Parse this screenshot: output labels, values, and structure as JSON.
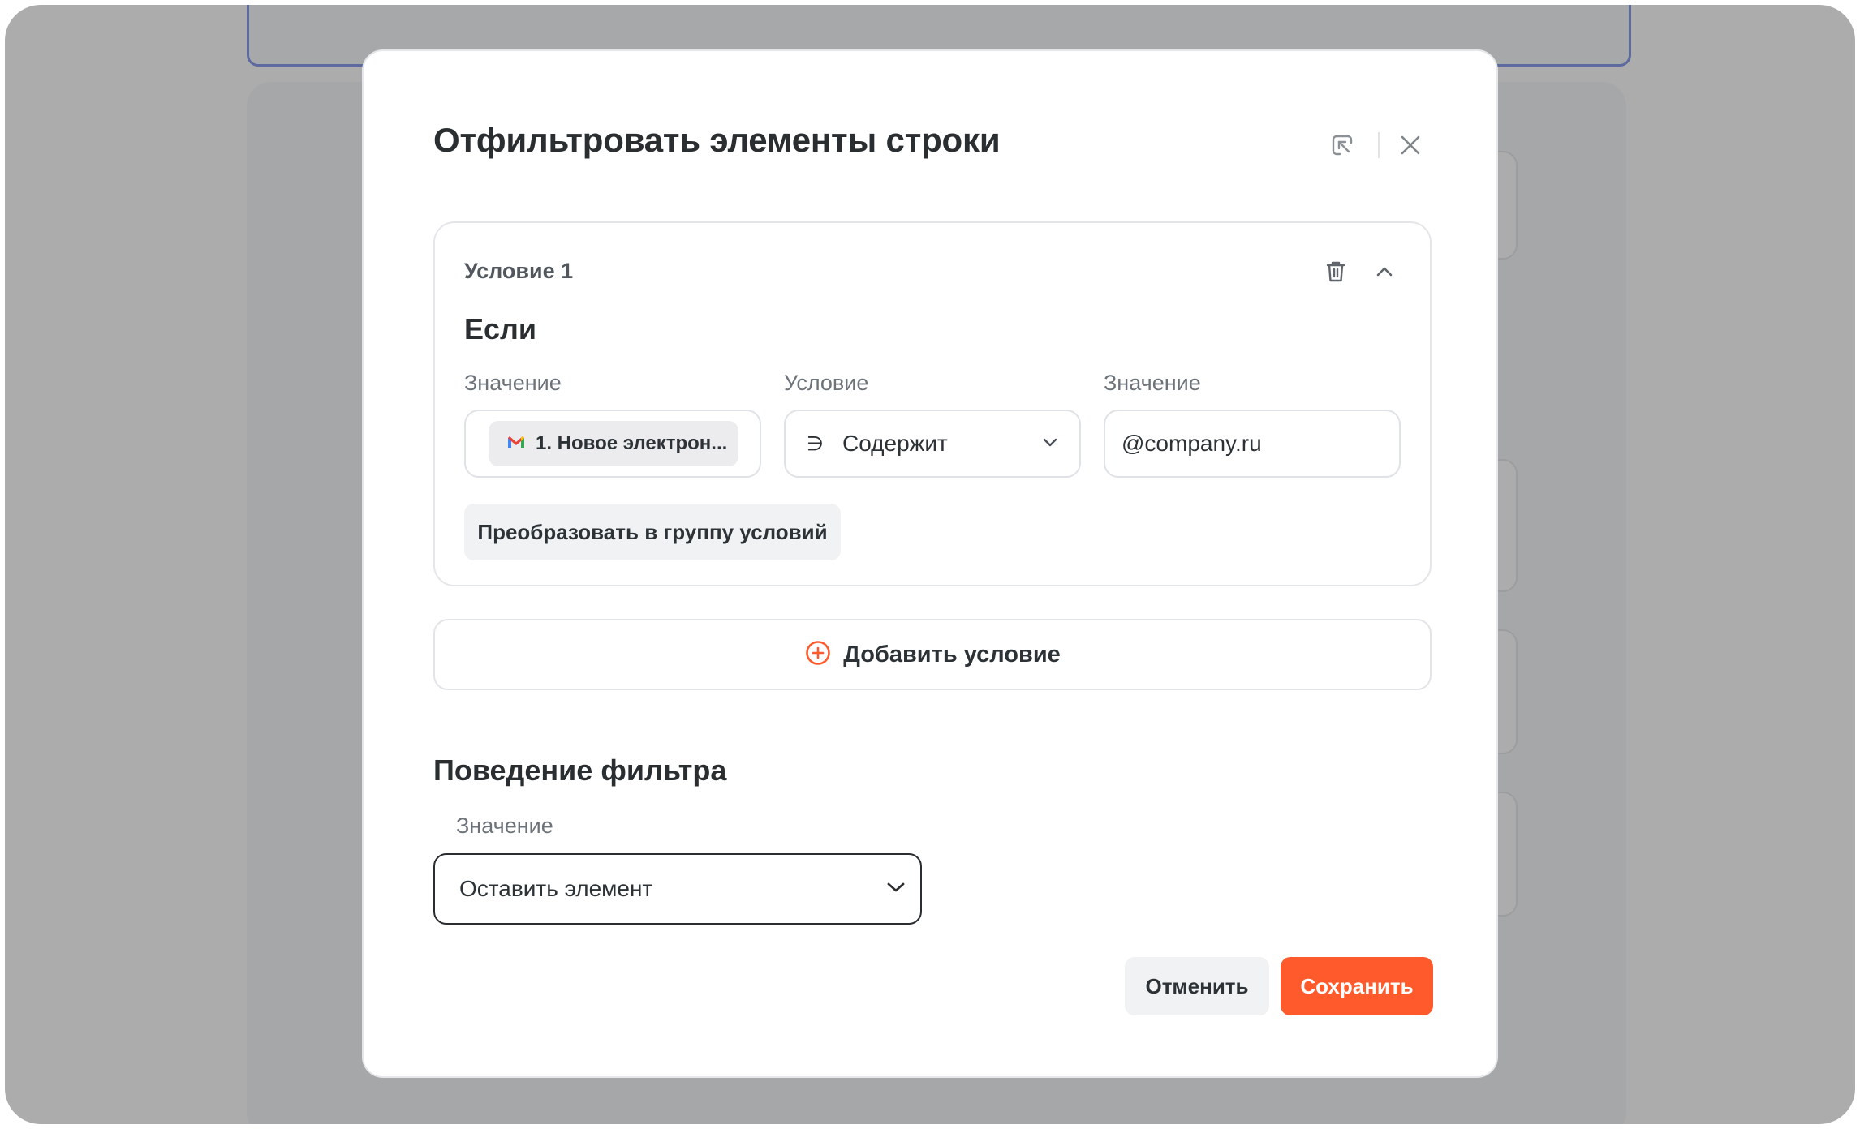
{
  "modal": {
    "title": "Отфильтровать элементы строки",
    "header_icons": [
      "open-in-panel-icon",
      "close-icon"
    ]
  },
  "condition": {
    "label": "Условие 1",
    "if_label": "Если",
    "icons": [
      "trash-icon",
      "chevron-up-icon"
    ],
    "value_field": {
      "label": "Значение",
      "chip_app_icon": "gmail-icon",
      "chip_text": "1. Новое электрон..."
    },
    "operator_field": {
      "label": "Условие",
      "symbol": "∋",
      "selected": "Содержит"
    },
    "compare_field": {
      "label": "Значение",
      "value": "@company.ru"
    },
    "convert_button": "Преобразовать в группу условий"
  },
  "add_condition": {
    "label": "Добавить условие",
    "icon": "plus-circle-icon"
  },
  "behavior": {
    "title": "Поведение фильтра",
    "field_label": "Значение",
    "selected": "Оставить элемент"
  },
  "footer": {
    "cancel": "Отменить",
    "save": "Сохранить"
  },
  "colors": {
    "accent": "#ff5a2c",
    "overlay": "#7a7a7a",
    "background_highlight": "#5a76e6"
  }
}
